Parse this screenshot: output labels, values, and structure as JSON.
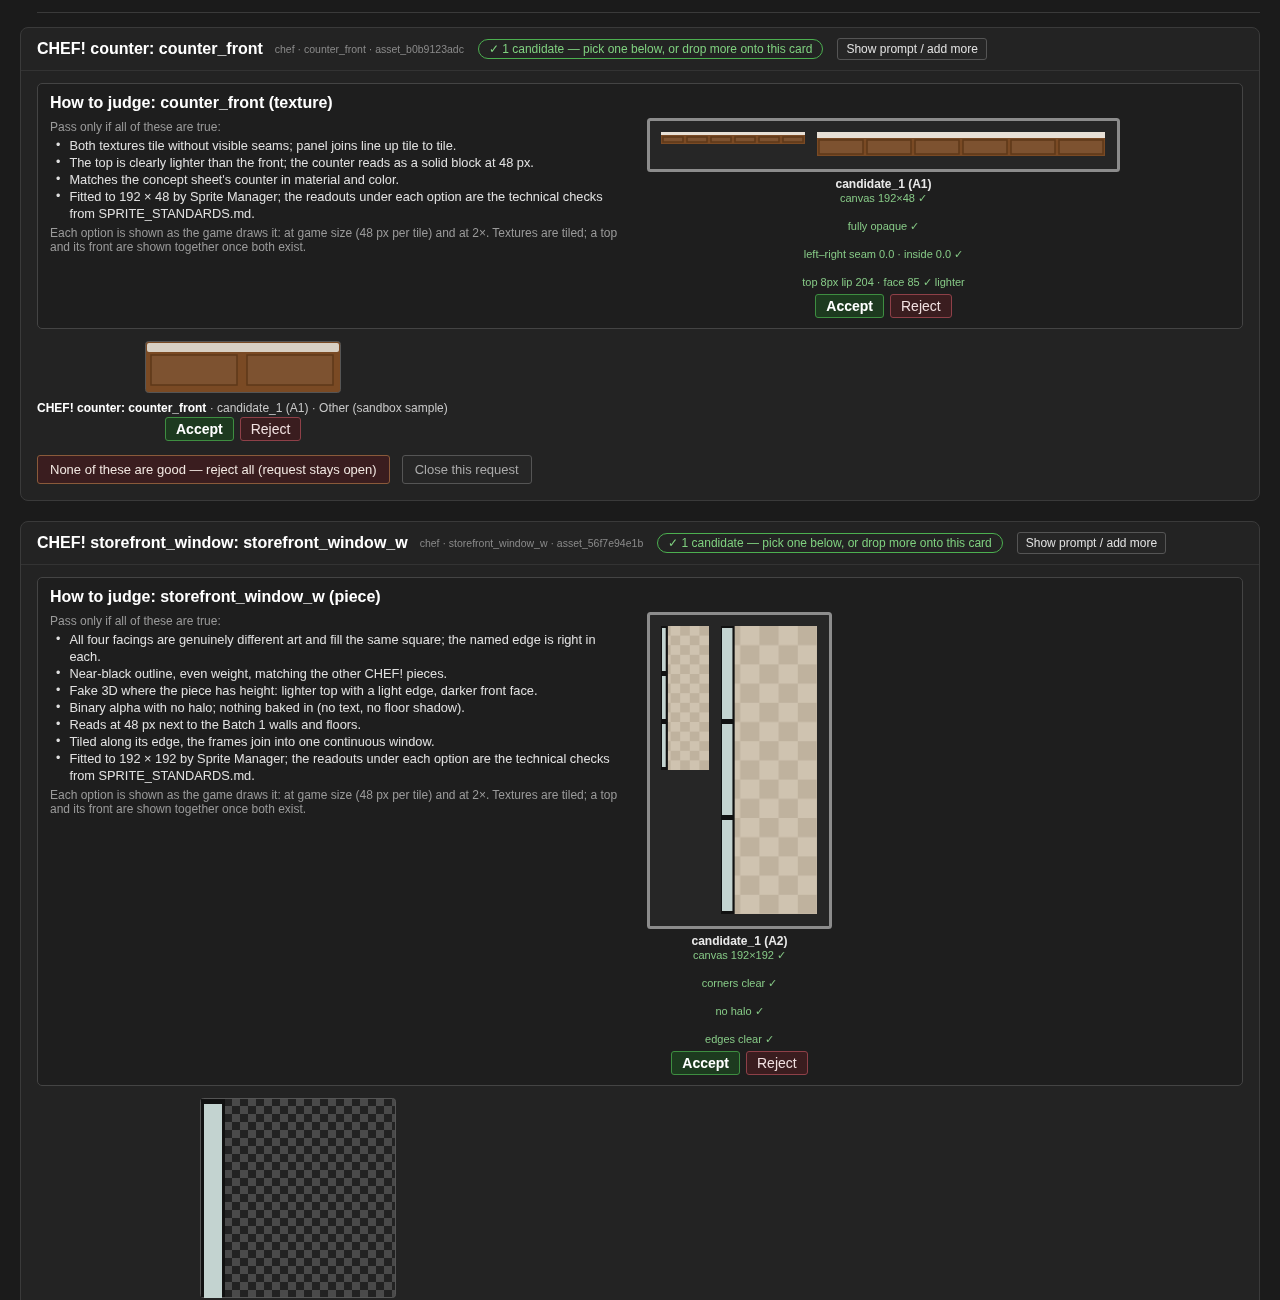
{
  "requests": [
    {
      "kind": "texture",
      "title": "CHEF! counter: counter_front",
      "meta": "chef · counter_front · asset_b0b9123adc",
      "status": "✓ 1 candidate — pick one below, or drop more onto this card",
      "prompt_button": "Show prompt / add more",
      "guide": {
        "heading": "How to judge: counter_front (texture)",
        "intro": "Pass only if all of these are true:",
        "marker": "•",
        "criteria": [
          "Both textures tile without visible seams; panel joins line up tile to tile.",
          "The top is clearly lighter than the front; the counter reads as a solid block at 48 px.",
          "Matches the concept sheet's counter in material and color.",
          "Fitted to 192 × 48 by Sprite Manager; the readouts under each option are the technical checks from SPRITE_STANDARDS.md."
        ],
        "note": "Each option is shown as the game draws it: at game size (48 px per tile) and at 2×. Textures are tiled; a top and its front are shown together once both exist."
      },
      "candidates": [
        {
          "label": "candidate_1 (A1)",
          "checks": [
            "canvas 192×48 ✓",
            "fully opaque ✓",
            "left–right seam 0.0 · inside 0.0 ✓",
            "top 8px lip 204 · face 85 ✓ lighter"
          ],
          "accept": "Accept",
          "reject": "Reject"
        }
      ],
      "sample": {
        "caption": "**CHEF! counter: counter_front** · candidate_1 (A1) · Other (sandbox sample)",
        "accept": "Accept",
        "reject": "Reject"
      },
      "footer": {
        "reject_all": "None of these are good — reject all (request stays open)",
        "close": "Close this request"
      }
    },
    {
      "kind": "piece",
      "title": "CHEF! storefront_window: storefront_window_w",
      "meta": "chef · storefront_window_w · asset_56f7e94e1b",
      "status": "✓ 1 candidate — pick one below, or drop more onto this card",
      "prompt_button": "Show prompt / add more",
      "guide": {
        "heading": "How to judge: storefront_window_w (piece)",
        "intro": "Pass only if all of these are true:",
        "marker": "•",
        "criteria": [
          "All four facings are genuinely different art and fill the same square; the named edge is right in each.",
          "Near-black outline, even weight, matching the other CHEF! pieces.",
          "Fake 3D where the piece has height: lighter top with a light edge, darker front face.",
          "Binary alpha with no halo; nothing baked in (no text, no floor shadow).",
          "Reads at 48 px next to the Batch 1 walls and floors.",
          "Tiled along its edge, the frames join into one continuous window.",
          "Fitted to 192 × 192 by Sprite Manager; the readouts under each option are the technical checks from SPRITE_STANDARDS.md."
        ],
        "note": "Each option is shown as the game draws it: at game size (48 px per tile) and at 2×. Textures are tiled; a top and its front are shown together once both exist."
      },
      "candidates": [
        {
          "label": "candidate_1 (A2)",
          "checks": [
            "canvas 192×192 ✓",
            "corners clear ✓",
            "no halo ✓",
            "edges clear ✓"
          ],
          "accept": "Accept",
          "reject": "Reject"
        }
      ]
    }
  ]
}
